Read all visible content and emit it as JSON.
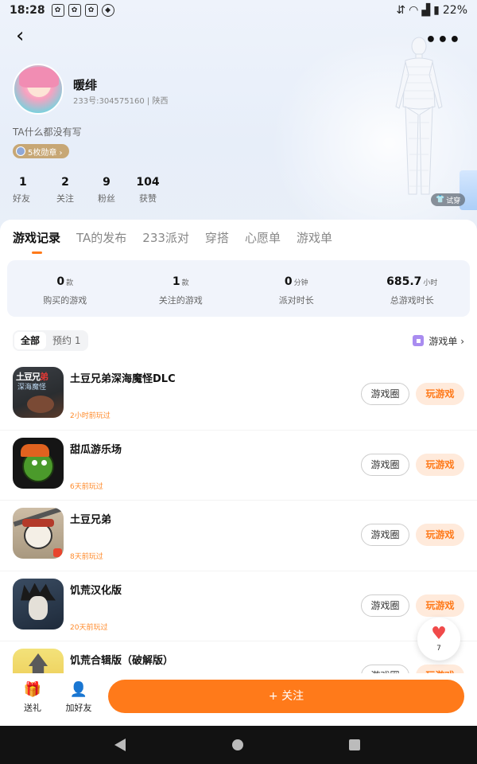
{
  "status_bar": {
    "time": "18:28",
    "battery": "22%",
    "icons": [
      "paw-icon",
      "paw-icon",
      "paw-icon",
      "soccer-icon",
      "wifi-icon",
      "signal-icon",
      "battery-icon"
    ]
  },
  "header": {
    "more_label": "•••",
    "username": "暖绯",
    "user_meta": "233号:304575160 | 陕西",
    "bio": "TA什么都没有写",
    "badge_label": "5枚勋章 ›",
    "try_on_label": "试穿"
  },
  "stats": [
    {
      "value": "1",
      "label": "好友"
    },
    {
      "value": "2",
      "label": "关注"
    },
    {
      "value": "9",
      "label": "粉丝"
    },
    {
      "value": "104",
      "label": "获赞"
    }
  ],
  "tabs": [
    {
      "label": "游戏记录",
      "active": true
    },
    {
      "label": "TA的发布",
      "active": false
    },
    {
      "label": "233派对",
      "active": false
    },
    {
      "label": "穿搭",
      "active": false
    },
    {
      "label": "心愿单",
      "active": false
    },
    {
      "label": "游戏单",
      "active": false
    }
  ],
  "summary": [
    {
      "value": "0",
      "unit": "款",
      "label": "购买的游戏"
    },
    {
      "value": "1",
      "unit": "款",
      "label": "关注的游戏"
    },
    {
      "value": "0",
      "unit": "分钟",
      "label": "派对时长"
    },
    {
      "value": "685.7",
      "unit": "小时",
      "label": "总游戏时长"
    }
  ],
  "filter": {
    "all_label": "全部",
    "reserve_label": "预约 1",
    "gamelist_label": "游戏单 ›"
  },
  "games": [
    {
      "title": "土豆兄弟深海魔怪DLC",
      "played": "2小时前玩过",
      "circle_label": "游戏圈",
      "play_label": "玩游戏",
      "icon_text_a": "土豆兄",
      "icon_text_b": "弟",
      "icon_text_c": "深海魔怪"
    },
    {
      "title": "甜瓜游乐场",
      "played": "6天前玩过",
      "circle_label": "游戏圈",
      "play_label": "玩游戏"
    },
    {
      "title": "土豆兄弟",
      "played": "8天前玩过",
      "circle_label": "游戏圈",
      "play_label": "玩游戏"
    },
    {
      "title": "饥荒汉化版",
      "played": "20天前玩过",
      "circle_label": "游戏圈",
      "play_label": "玩游戏"
    },
    {
      "title": "饥荒合辑版（破解版）",
      "played": "",
      "circle_label": "游戏圈",
      "play_label": "玩游戏"
    }
  ],
  "floating": {
    "heart_count": "7"
  },
  "action_bar": {
    "gift_label": "送礼",
    "add_friend_label": "加好友",
    "follow_label": "+ 关注"
  },
  "colors": {
    "accent": "#ff7a1a",
    "play_bg": "#ffeadb",
    "summary_bg": "#f1f4fb"
  }
}
